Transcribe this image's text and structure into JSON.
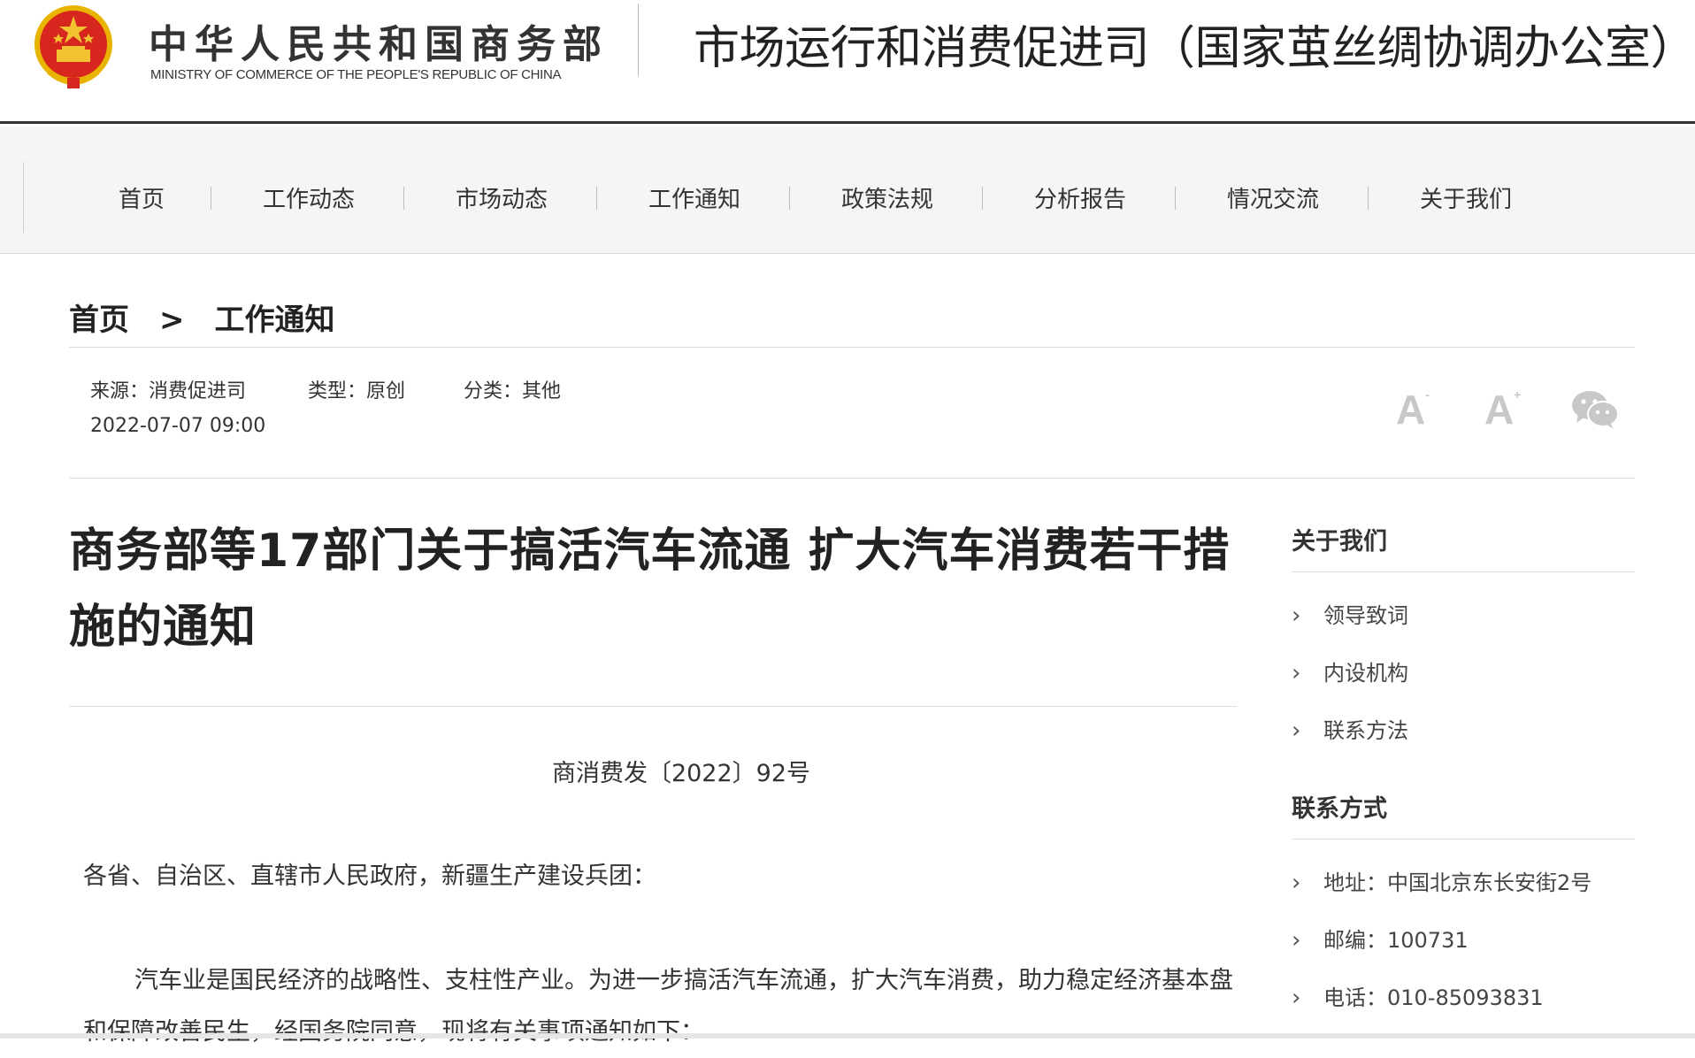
{
  "header": {
    "ministry_cn": "中华人民共和国商务部",
    "ministry_en": "MINISTRY OF COMMERCE OF THE PEOPLE'S REPUBLIC OF CHINA",
    "dept_title": "市场运行和消费促进司（国家茧丝绸协调办公室）",
    "emblem_icon": "national-emblem-icon"
  },
  "nav": {
    "items": [
      "首页",
      "工作动态",
      "市场动态",
      "工作通知",
      "政策法规",
      "分析报告",
      "情况交流",
      "关于我们"
    ]
  },
  "breadcrumb": {
    "home": "首页",
    "separator": ">",
    "current": "工作通知"
  },
  "meta": {
    "source": "来源：消费促进司",
    "type": "类型：原创",
    "category": "分类：其他",
    "datetime": "2022-07-07 09:00"
  },
  "tools": {
    "decrease_font_label": "A",
    "increase_font_label": "A",
    "decrease_sup": "-",
    "increase_sup": "+",
    "share_icon": "wechat-icon"
  },
  "article": {
    "title": "商务部等17部门关于搞活汽车流通 扩大汽车消费若干措施的通知",
    "doc_number": "商消费发〔2022〕92号",
    "salutation": "各省、自治区、直辖市人民政府，新疆生产建设兵团：",
    "paragraph_1": "汽车业是国民经济的战略性、支柱性产业。为进一步搞活汽车流通，扩大汽车消费，助力稳定经济基本盘和保障改善民生，经国务院同意，现将有关事项通知如下："
  },
  "sidebar": {
    "about_heading": "关于我们",
    "about_items": [
      "领导致词",
      "内设机构",
      "联系方法"
    ],
    "contact_heading": "联系方式",
    "contact_items": [
      "地址：中国北京东长安街2号",
      "邮编：100731",
      "电话：010-85093831"
    ]
  },
  "colors": {
    "header_rule": "#333333",
    "nav_bg": "#f5f5f5",
    "emblem_red": "#d7261e",
    "emblem_gold": "#f2c230",
    "tool_gray": "#c8c8c8"
  }
}
